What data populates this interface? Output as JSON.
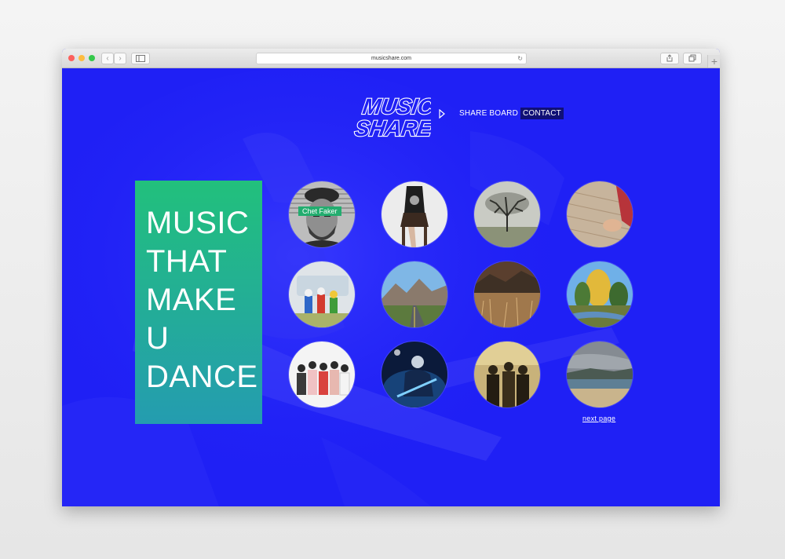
{
  "browser": {
    "url": "musicshare.com",
    "back_glyph": "‹",
    "forward_glyph": "›",
    "new_tab_glyph": "+"
  },
  "site": {
    "logo_line1": "MUSIC",
    "logo_line2": "SHARE",
    "nav": {
      "share_board": "SHARE BOARD",
      "contact": "CONTACT"
    },
    "hero_lines": [
      "MUSIC",
      "THAT",
      "MAKE",
      "U",
      "DANCE"
    ],
    "featured_tag": "Chet Faker",
    "next_page": "next page"
  },
  "colors": {
    "background": "#1f20f5",
    "hero_top": "#22c07c",
    "hero_bottom": "#249cb0",
    "tag": "#23ad6f",
    "contact_bg": "#101076"
  },
  "icons": [
    "share-icon",
    "tabs-icon",
    "sidebar-icon",
    "reload-icon",
    "triangle-right-icon"
  ]
}
